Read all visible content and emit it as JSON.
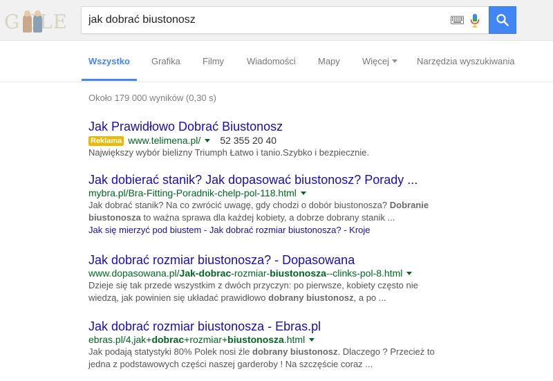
{
  "header": {
    "logo_text": "GOOGLE",
    "search_value": "jak dobrać biustonosz",
    "icons": {
      "keyboard": "keyboard-icon",
      "mic": "mic-icon",
      "search": "search-icon"
    }
  },
  "tabs": [
    {
      "label": "Wszystko",
      "active": true
    },
    {
      "label": "Grafika"
    },
    {
      "label": "Filmy"
    },
    {
      "label": "Wiadomości"
    },
    {
      "label": "Mapy"
    },
    {
      "label": "Więcej"
    },
    {
      "label": "Narzędzia wyszukiwania"
    }
  ],
  "result_stats": "Około 179 000 wyników (0,30 s)",
  "ad": {
    "title": "Jak Prawidłowo Dobrać Biustonosz",
    "badge": "Reklama",
    "url": "www.telimena.pl/",
    "phone": "52 355 20 40",
    "snippet": "Największy wybór bielizny Triumph Łatwo i tanio.Szybko i bezpiecznie."
  },
  "results": [
    {
      "title": "Jak dobierać stanik? Jak dopasować biustonosz? Porady ...",
      "url": "mybra.pl/Bra-Fitting-Poradnik-chelp-pol-118.html",
      "snippet_parts": [
        {
          "text": "Jak dobrać stanik? Na co zwrócić uwagę, gdy chodzi o dobór biustonosza? ",
          "bold": false
        },
        {
          "text": "Dobranie biustonosza",
          "bold": true
        },
        {
          "text": " to ważna sprawa dla każdej kobiety, a dobrze dobrany stanik ...",
          "bold": false
        }
      ],
      "sitelinks": [
        "Jak się mierzyć pod biustem",
        "Jak dobrać rozmiar biustonosza?",
        "Kroje"
      ]
    },
    {
      "title": "Jak dobrać rozmiar biustonosza? - Dopasowana",
      "url_parts": [
        {
          "text": "www.dopasowana.pl/",
          "bold": false
        },
        {
          "text": "Jak-dobrac",
          "bold": true
        },
        {
          "text": "-rozmiar-",
          "bold": false
        },
        {
          "text": "biustonosza",
          "bold": true
        },
        {
          "text": "--clinks-pol-8.html",
          "bold": false
        }
      ],
      "snippet_parts": [
        {
          "text": "Dzieje się tak przede wszystkim z dwóch przyczyn: po pierwsze, kobiety często nie wiedzą, jak powinien się układać prawidłowo ",
          "bold": false
        },
        {
          "text": "dobrany biustonosz",
          "bold": true
        },
        {
          "text": ", a po ...",
          "bold": false
        }
      ]
    },
    {
      "title": "Jak dobrać rozmiar biustonosza - Ebras.pl",
      "url_parts": [
        {
          "text": "ebras.pl/4,jak+",
          "bold": false
        },
        {
          "text": "dobrac",
          "bold": true
        },
        {
          "text": "+rozmiar+",
          "bold": false
        },
        {
          "text": "biustonosza",
          "bold": true
        },
        {
          "text": ".html",
          "bold": false
        }
      ],
      "snippet_parts": [
        {
          "text": "Jak podają statystyki 80% Polek nosi źle ",
          "bold": false
        },
        {
          "text": "dobrany biustonosz",
          "bold": true
        },
        {
          "text": ". Dlaczego ? Przecież to jedna z podstawowych części naszej garderoby ! Na szczęście coraz ...",
          "bold": false
        }
      ]
    }
  ],
  "colors": {
    "link": "#1a0dab",
    "url": "#006621",
    "accent": "#4285f4",
    "ad_badge": "#edb802"
  }
}
